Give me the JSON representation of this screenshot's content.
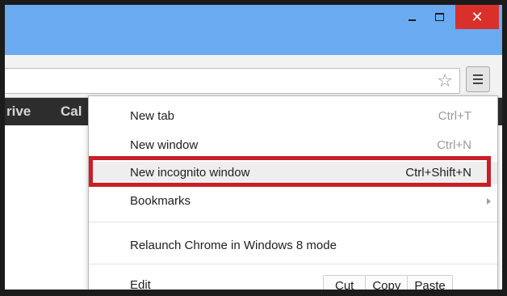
{
  "window": {
    "minimize_glyph": "minimize-icon",
    "maximize_glyph": "maximize-icon",
    "close_label": "✕"
  },
  "toolbar": {
    "star_icon": "☆",
    "menu_icon": "hamburger-icon"
  },
  "appsbar": {
    "items": [
      "rive",
      "Cal"
    ]
  },
  "menu": {
    "items": [
      {
        "label": "New tab",
        "shortcut": "Ctrl+T"
      },
      {
        "label": "New window",
        "shortcut": "Ctrl+N"
      },
      {
        "label": "New incognito window",
        "shortcut": "Ctrl+Shift+N"
      },
      {
        "label": "Bookmarks",
        "shortcut": ""
      },
      {
        "label": "Relaunch Chrome in Windows 8 mode",
        "shortcut": ""
      },
      {
        "label": "Edit",
        "shortcut": ""
      }
    ],
    "edit_buttons": [
      "Cut",
      "Copy",
      "Paste"
    ]
  },
  "colors": {
    "title_bar": "#6aaaf0",
    "close_button": "#d9302b",
    "highlight": "#c91f26"
  }
}
